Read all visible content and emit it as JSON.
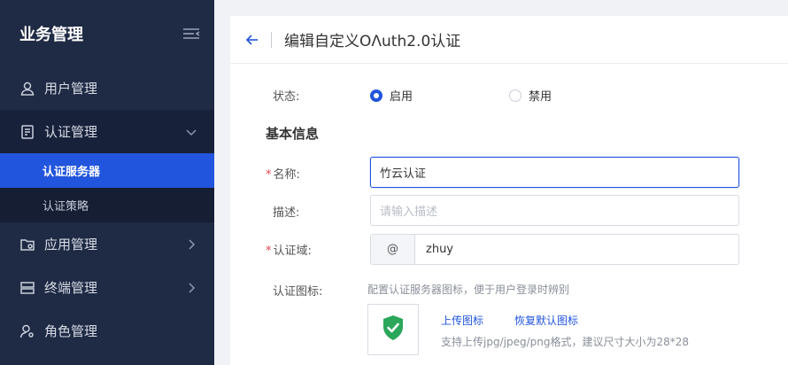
{
  "sidebar": {
    "title": "业务管理",
    "items": [
      {
        "label": "用户管理",
        "icon": "user-icon"
      },
      {
        "label": "认证管理",
        "icon": "certificate-icon",
        "expanded": true,
        "children": [
          {
            "label": "认证服务器",
            "active": true
          },
          {
            "label": "认证策略",
            "active": false
          }
        ]
      },
      {
        "label": "应用管理",
        "icon": "app-settings-icon"
      },
      {
        "label": "终端管理",
        "icon": "terminal-icon"
      },
      {
        "label": "角色管理",
        "icon": "role-icon"
      }
    ]
  },
  "header": {
    "title": "编辑自定义OΛuth2.0认证"
  },
  "form": {
    "status": {
      "label": "状态:",
      "options": [
        {
          "label": "启用",
          "selected": true
        },
        {
          "label": "禁用",
          "selected": false
        }
      ]
    },
    "section_title": "基本信息",
    "name": {
      "label": "名称:",
      "value": "竹云认证",
      "required": true
    },
    "description": {
      "label": "描述:",
      "placeholder": "请输入描述"
    },
    "domain": {
      "label": "认证域:",
      "prefix": "@",
      "value": "zhuy",
      "required": true
    },
    "icon": {
      "label": "认证图标:",
      "hint": "配置认证服务器图标，便于用户登录时辨别",
      "upload_label": "上传图标",
      "restore_label": "恢复默认图标",
      "format_hint": "支持上传jpg/jpeg/png格式，建议尺寸大小为28*28"
    }
  },
  "colors": {
    "sidebar_bg": "#1f2a44",
    "accent": "#2255dd",
    "shield_green": "#2aa75a",
    "required": "#e0454b"
  }
}
